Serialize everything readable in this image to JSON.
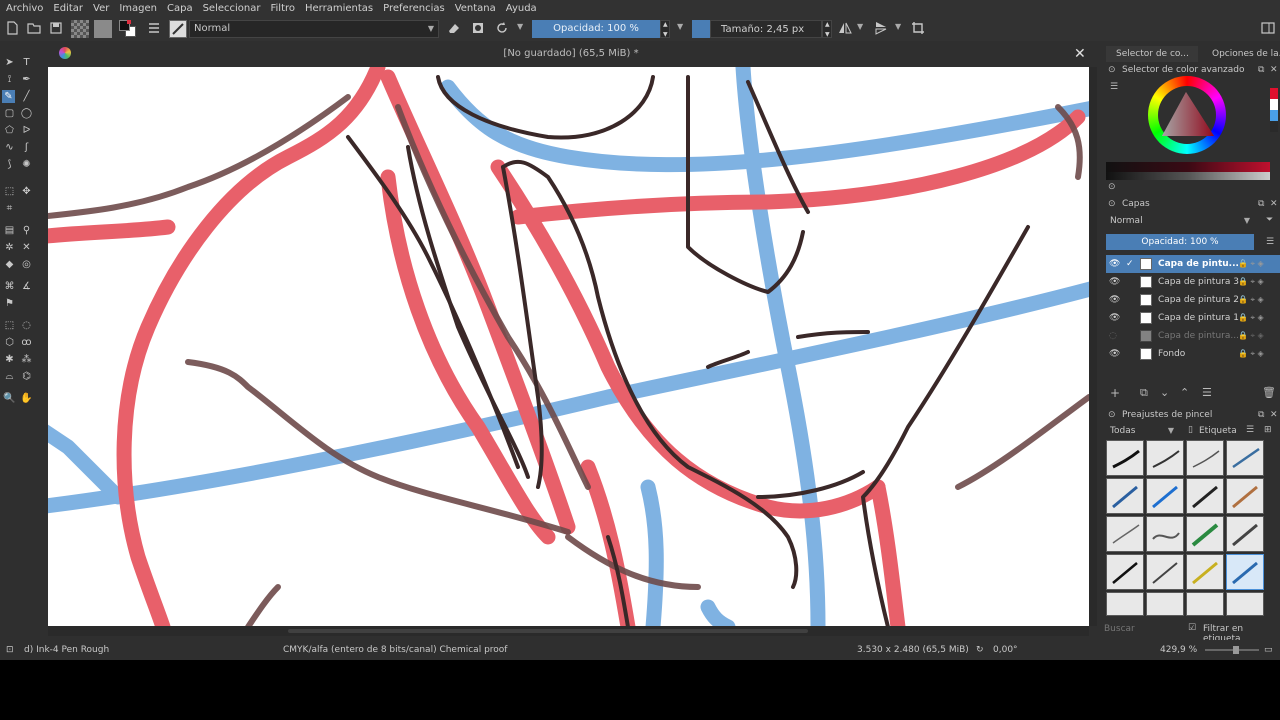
{
  "menu": [
    "Archivo",
    "Editar",
    "Ver",
    "Imagen",
    "Capa",
    "Seleccionar",
    "Filtro",
    "Herramientas",
    "Preferencias",
    "Ventana",
    "Ayuda"
  ],
  "toolbar": {
    "blend_mode": "Normal",
    "opacity": "Opacidad: 100 %",
    "size": "Tamaño: 2,45 px"
  },
  "document": {
    "title": "[No guardado]  (65,5 MiB) *"
  },
  "docker": {
    "tabs": [
      "Selector de co...",
      "Opciones de la..."
    ],
    "color_selector_title": "Selector de color avanzado",
    "layers_title": "Capas",
    "layers_blend": "Normal",
    "layers_opacity": "Opacidad:  100 %",
    "layers": [
      {
        "name": "Capa de pintu...",
        "active": true,
        "visible": true
      },
      {
        "name": "Capa de pintura 3",
        "active": false,
        "visible": true
      },
      {
        "name": "Capa de pintura 2",
        "active": false,
        "visible": true
      },
      {
        "name": "Capa de pintura 1",
        "active": false,
        "visible": true
      },
      {
        "name": "Capa de pintura...",
        "active": false,
        "visible": false
      },
      {
        "name": "Fondo",
        "active": false,
        "visible": true
      }
    ],
    "brush_title": "Preajustes de pincel",
    "brush_filter": "Todas",
    "brush_tag": "Etiqueta",
    "search_placeholder": "Buscar",
    "filter_tag_label": "Filtrar en etiqueta"
  },
  "status": {
    "brush": "d) Ink-4 Pen Rough",
    "color_profile": "CMYK/alfa (entero de 8 bits/canal)  Chemical proof",
    "dimensions": "3.530 x 2.480 (65,5 MiB)",
    "rotation": "0,00°",
    "zoom": "429,9 %"
  },
  "colors": {
    "accent": "#4a7eb5",
    "stroke_red": "#e8606a",
    "stroke_blue": "#7fb2e2",
    "stroke_brown": "#5a3a3a"
  }
}
